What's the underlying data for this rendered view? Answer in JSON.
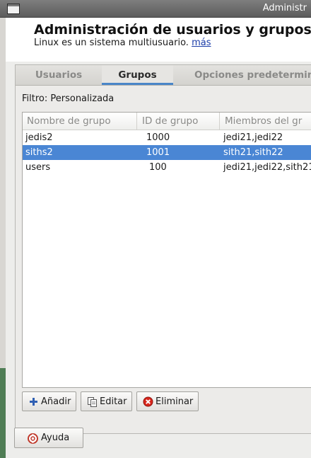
{
  "window": {
    "title": "Administr"
  },
  "header": {
    "title": "Administración de usuarios y grupos",
    "subtitle": "Linux es un sistema multiusuario.",
    "more_link": "más"
  },
  "tabs": [
    {
      "label": "Usuarios",
      "active": false
    },
    {
      "label": "Grupos",
      "active": true
    },
    {
      "label": "Opciones predetermin",
      "active": false
    }
  ],
  "filter": {
    "label": "Filtro: Personalizada"
  },
  "table": {
    "columns": [
      "Nombre de grupo",
      "ID de grupo",
      "Miembros del gr"
    ],
    "rows": [
      {
        "name": "jedis2",
        "id": "1000",
        "members": "jedi21,jedi22",
        "selected": false
      },
      {
        "name": "siths2",
        "id": "1001",
        "members": "sith21,sith22",
        "selected": true
      },
      {
        "name": "users",
        "id": "100",
        "members": "jedi21,jedi22,sith21,",
        "selected": false
      }
    ]
  },
  "actions": {
    "add": "Añadir",
    "edit": "Editar",
    "delete": "Eliminar"
  },
  "footer": {
    "help": "Ayuda"
  },
  "colors": {
    "selection": "#4a86d4",
    "tab_indicator": "#4a86c8",
    "link": "#1b3ca8"
  },
  "icons": [
    "window-menu-icon",
    "add-icon",
    "edit-icon",
    "delete-icon",
    "help-icon"
  ]
}
